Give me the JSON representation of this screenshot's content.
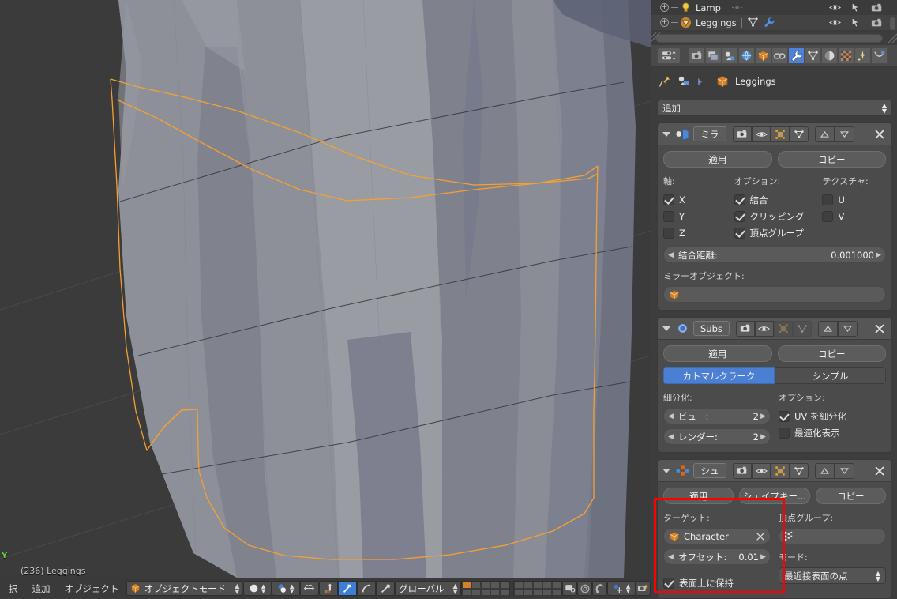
{
  "viewport": {
    "stats_text": "(236) Leggings",
    "axis_label": "Y",
    "background": "#3b3b3b",
    "mesh_outline_color": "#f0a030",
    "object_name": "Leggings"
  },
  "bottom_header": {
    "menus": [
      "択",
      "追加",
      "オブジェクト"
    ],
    "mode_dropdown": {
      "label": "オブジェクトモード",
      "icon": "object-cube-icon"
    },
    "shading_dropdown": {
      "icon": "shading-solid-icon"
    },
    "pivot_dropdown": {
      "icon": "pivot-median-icon"
    },
    "manipulator_toggle": {
      "icon": "manipulator-icon"
    },
    "transform_icons": [
      "translate-icon",
      "rotate-icon",
      "scale-icon"
    ],
    "orientation_dropdown": {
      "label": "グローバル"
    },
    "layers_label": "layer-grid",
    "extra_icons": [
      "render-region-icon",
      "proportional-edit-icon",
      "snap-magnet-icon",
      "snap-target-icon",
      "camera-add-icon"
    ]
  },
  "outliner": {
    "rows": [
      {
        "name": "Lamp",
        "icon": "lamp-icon",
        "extra_icons": [
          "lamp-data-icon"
        ]
      },
      {
        "name": "Leggings",
        "icon": "mesh-object-icon",
        "extra_icons": [
          "mesh-data-icon",
          "wrench-modifier-icon"
        ]
      }
    ],
    "row_icons": [
      "eye-visibility-icon",
      "cursor-selectable-icon",
      "camera-render-icon"
    ]
  },
  "properties": {
    "tabs": [
      {
        "name": "render-tab",
        "icon": "camera-icon",
        "active": false
      },
      {
        "name": "render-layers-tab",
        "icon": "images-icon",
        "active": false
      },
      {
        "name": "scene-tab",
        "icon": "scene-icon",
        "active": false
      },
      {
        "name": "world-tab",
        "icon": "world-globe-icon",
        "active": false
      },
      {
        "name": "object-tab",
        "icon": "object-cube-icon",
        "active": false
      },
      {
        "name": "constraints-tab",
        "icon": "chain-link-icon",
        "active": false
      },
      {
        "name": "modifiers-tab",
        "icon": "wrench-icon",
        "active": true
      },
      {
        "name": "object-data-tab",
        "icon": "mesh-triangle-icon",
        "active": false
      },
      {
        "name": "material-tab",
        "icon": "material-sphere-icon",
        "active": false
      },
      {
        "name": "texture-tab",
        "icon": "checker-texture-icon",
        "active": false
      },
      {
        "name": "particles-tab",
        "icon": "particles-icon",
        "active": false
      },
      {
        "name": "physics-tab",
        "icon": "physics-icon",
        "active": false
      }
    ],
    "breadcrumb": {
      "object_name": "Leggings",
      "pin_icon": "pin-icon",
      "scene-icon": "scene-icon"
    },
    "add_modifier": {
      "label": "追加"
    }
  },
  "modifiers": [
    {
      "id": "mirror",
      "header": {
        "name": "ミラ",
        "icon": "mirror-modifier-icon",
        "toggles": [
          {
            "name": "render-toggle",
            "icon": "camera-icon",
            "on": true
          },
          {
            "name": "viewport-toggle",
            "icon": "eye-icon",
            "on": true
          },
          {
            "name": "edit-mode-toggle",
            "icon": "edit-mode-icon",
            "on": true
          },
          {
            "name": "cage-toggle",
            "icon": "cage-icon",
            "on": true
          }
        ],
        "move_up": "move-up-icon",
        "move_down": "move-down-icon",
        "close": "close-icon"
      },
      "apply_label": "適用",
      "copy_label": "コピー",
      "columns": [
        {
          "title": "軸:",
          "items": [
            {
              "label": "X",
              "checked": true
            },
            {
              "label": "Y",
              "checked": false
            },
            {
              "label": "Z",
              "checked": false
            }
          ]
        },
        {
          "title": "オプション:",
          "items": [
            {
              "label": "結合",
              "checked": true
            },
            {
              "label": "クリッピング",
              "checked": true
            },
            {
              "label": "頂点グループ",
              "checked": true
            }
          ]
        },
        {
          "title": "テクスチャ:",
          "items": [
            {
              "label": "U",
              "checked": false
            },
            {
              "label": "V",
              "checked": false
            }
          ]
        }
      ],
      "merge_limit": {
        "label": "結合距離:",
        "value": "0.001000"
      },
      "mirror_object": {
        "label": "ミラーオブジェクト:",
        "value": "",
        "icon": "object-cube-icon"
      }
    },
    {
      "id": "subsurf",
      "header": {
        "name": "Subs",
        "icon": "subsurf-modifier-icon",
        "toggles": [
          {
            "name": "render-toggle",
            "icon": "camera-icon",
            "on": true
          },
          {
            "name": "viewport-toggle",
            "icon": "eye-icon",
            "on": true
          },
          {
            "name": "edit-mode-toggle",
            "icon": "edit-mode-icon",
            "on": false
          },
          {
            "name": "cage-toggle",
            "icon": "cage-icon",
            "on": false
          }
        ],
        "move_up": "move-up-icon",
        "move_down": "move-down-icon",
        "close": "close-icon"
      },
      "apply_label": "適用",
      "copy_label": "コピー",
      "algorithm": {
        "options": [
          "カトマルクラーク",
          "シンプル"
        ],
        "selected": "カトマルクラーク"
      },
      "subdiv_title": "細分化:",
      "view_level": {
        "label": "ビュー:",
        "value": "2"
      },
      "render_level": {
        "label": "レンダー:",
        "value": "2"
      },
      "options_title": "オプション:",
      "options": [
        {
          "label": "UV を細分化",
          "checked": true
        },
        {
          "label": "最適化表示",
          "checked": false
        }
      ]
    },
    {
      "id": "shrinkwrap",
      "header": {
        "name": "シュ",
        "icon": "shrinkwrap-modifier-icon",
        "toggles": [
          {
            "name": "render-toggle",
            "icon": "camera-icon",
            "on": true
          },
          {
            "name": "viewport-toggle",
            "icon": "eye-icon",
            "on": true
          },
          {
            "name": "edit-mode-toggle",
            "icon": "edit-mode-icon",
            "on": true
          },
          {
            "name": "cage-toggle",
            "icon": "cage-icon",
            "on": true
          }
        ],
        "move_up": "move-up-icon",
        "move_down": "move-down-icon",
        "close": "close-icon"
      },
      "apply_label": "適用",
      "shapekey_label": "シェイプキー...",
      "copy_label": "コピー",
      "target_title": "ターゲット:",
      "target_value": "Character",
      "offset": {
        "label": "オフセット:",
        "value": "0.01"
      },
      "keep_above": {
        "label": "表面上に保持",
        "checked": true
      },
      "vgroup_title": "頂点グループ:",
      "vgroup_value": "",
      "mode_title": "モード:",
      "mode_value": "最近接表面の点"
    }
  ],
  "annotation": {
    "highlight_color": "#ff0000"
  }
}
